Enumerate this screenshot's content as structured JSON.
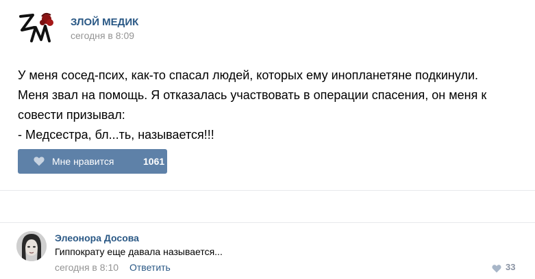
{
  "post": {
    "author": "ЗЛОЙ МЕДИК",
    "time": "сегодня в 8:09",
    "text_lines": [
      "У меня сосед-псих, как-то спасал людей, которых ему инопланетяне подкинули.",
      "Меня звал на помощь. Я отказалась участвовать в операции спасения, он меня к",
      "совести призывал:",
      "- Медсестра, бл...ть, называется!!!"
    ],
    "like_label": "Мне нравится",
    "like_count": "1061"
  },
  "comment": {
    "author": "Элеонора Досова",
    "text": "Гиппократу еще давала называется...",
    "time": "сегодня в 8:10",
    "reply_label": "Ответить",
    "like_count": "33"
  },
  "colors": {
    "link": "#2a5885",
    "like_button": "#5e81a8",
    "muted": "#939393"
  }
}
